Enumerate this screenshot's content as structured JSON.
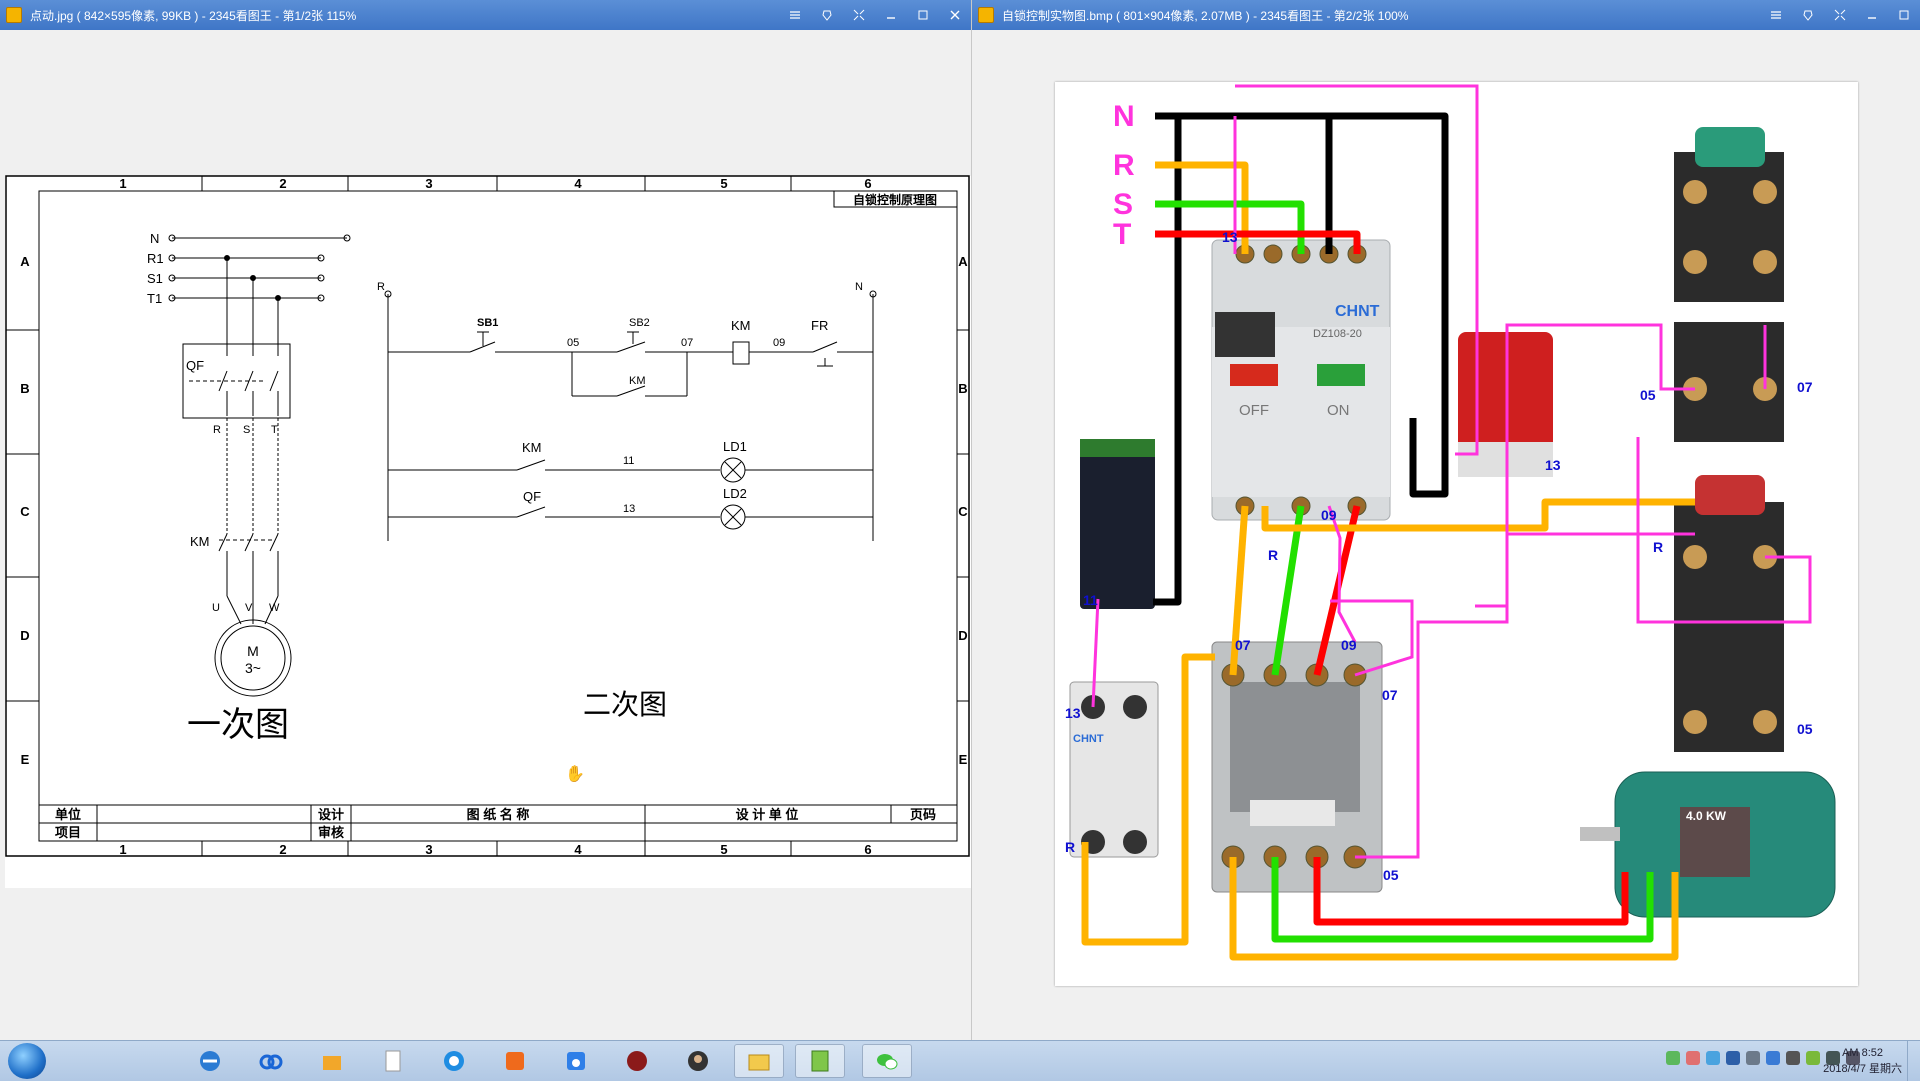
{
  "left_window": {
    "title": "点动.jpg ( 842×595像素, 99KB ) - 2345看图王 - 第1/2张 115%",
    "schematic": {
      "columns": [
        "1",
        "2",
        "3",
        "4",
        "5",
        "6"
      ],
      "rows": [
        "A",
        "B",
        "C",
        "D",
        "E"
      ],
      "drawing_name": "自锁控制原理图",
      "labels": {
        "n": "N",
        "r1": "R1",
        "s1": "S1",
        "t1": "T1",
        "qf": "QF",
        "r": "R",
        "s": "S",
        "t": "T",
        "km": "KM",
        "u": "U",
        "v": "V",
        "w": "W",
        "m": "M",
        "m3": "3~",
        "r_ctrl": "R",
        "n_ctrl": "N",
        "sb1": "SB1",
        "n05": "05",
        "sb2": "SB2",
        "n07": "07",
        "km_coil": "KM",
        "n09": "09",
        "fr": "FR",
        "km_hold": "KM",
        "km2": "KM",
        "n11": "11",
        "ld1": "LD1",
        "qf2": "QF",
        "n13": "13",
        "ld2": "LD2",
        "primary": "一次图",
        "secondary": "二次图"
      },
      "titleblock": {
        "unit": "单位",
        "design": "设计",
        "drawing_name": "图 纸 名 称",
        "design_unit": "设 计 单 位",
        "page": "页码",
        "project": "项目",
        "review": "审核"
      }
    }
  },
  "right_window": {
    "title": "自锁控制实物图.bmp ( 801×904像素, 2.07MB ) - 2345看图王 - 第2/2张 100%",
    "labels": {
      "n": "N",
      "r": "R",
      "s": "S",
      "t": "T",
      "brand": "CHNT",
      "model": "DZ108-20",
      "off": "OFF",
      "on": "ON",
      "w13a": "13",
      "w13b": "13",
      "w11": "11",
      "wr1": "R",
      "w09a": "09",
      "w07a": "07",
      "w09b": "09",
      "w07b": "07",
      "w05a": "05",
      "w07c": "07",
      "wr2": "R",
      "w05b": "05",
      "w05c": "05",
      "w13c": "13",
      "wr3": "R",
      "motor_power": "4.0 KW",
      "aux_brand": "CHNT"
    },
    "colors": {
      "n": "#000000",
      "r": "#ffb300",
      "s": "#22e000",
      "t": "#ff0000",
      "ctrl": "#ff33dd",
      "label": "#ff33dd",
      "num": "#1010d0"
    }
  },
  "window_controls": [
    "minimize-icon",
    "pin-icon",
    "fullscreen-icon",
    "restore-icon",
    "close-icon"
  ],
  "taskbar": {
    "apps": [
      "ie-icon",
      "baidu-netdisk-icon",
      "folder-box-icon",
      "document-icon",
      "360-browser-icon",
      "music-icon",
      "baidu-icon",
      "game-icon",
      "avatar-icon",
      "file-explorer-icon",
      "notepad-icon",
      "wechat-icon"
    ],
    "clock_time": "AM 8:52",
    "clock_date": "2018/4/7 星期六"
  }
}
